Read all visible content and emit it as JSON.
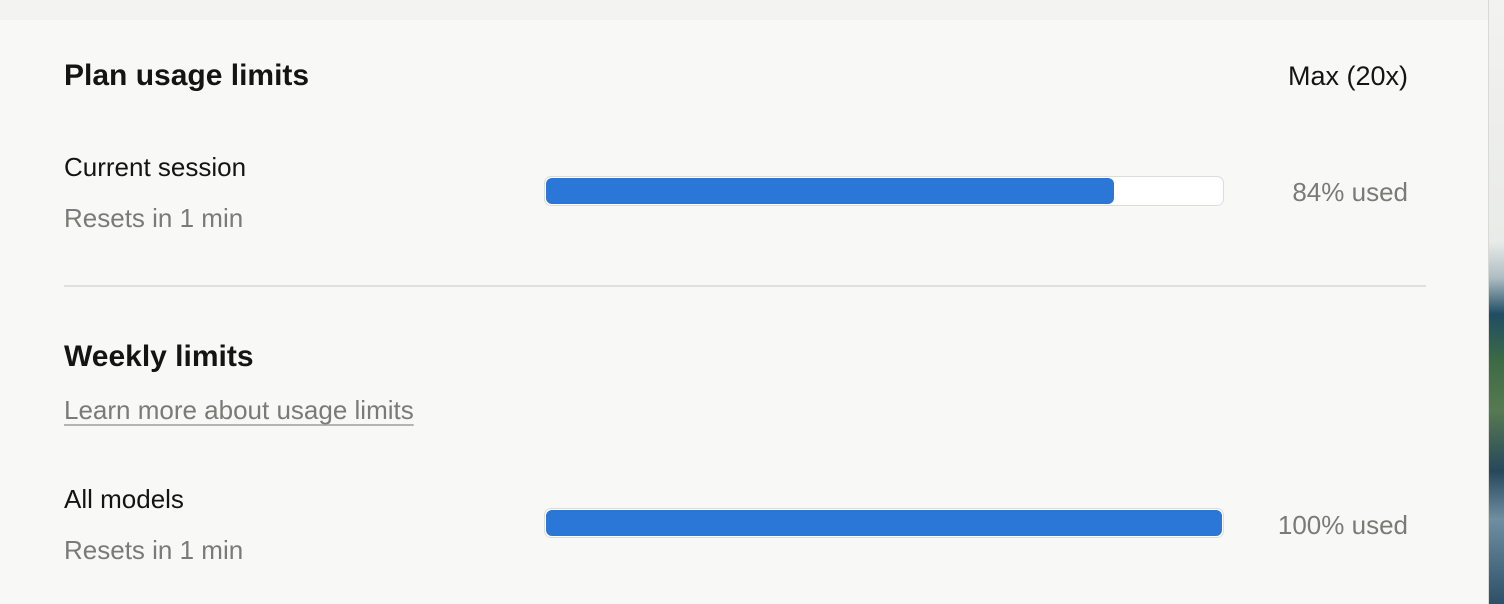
{
  "plan_usage": {
    "title": "Plan usage limits",
    "plan_name": "Max (20x)",
    "current_session": {
      "label": "Current session",
      "reset_text": "Resets in 1 min",
      "percent_used": 84,
      "used_text": "84% used"
    }
  },
  "weekly_limits": {
    "title": "Weekly limits",
    "learn_more_link": "Learn more about usage limits",
    "all_models": {
      "label": "All models",
      "reset_text": "Resets in 1 min",
      "percent_used": 100,
      "used_text": "100% used"
    }
  },
  "colors": {
    "bar_fill": "#2b77d8",
    "bar_track": "#ffffff",
    "panel_background": "#f8f8f6"
  }
}
